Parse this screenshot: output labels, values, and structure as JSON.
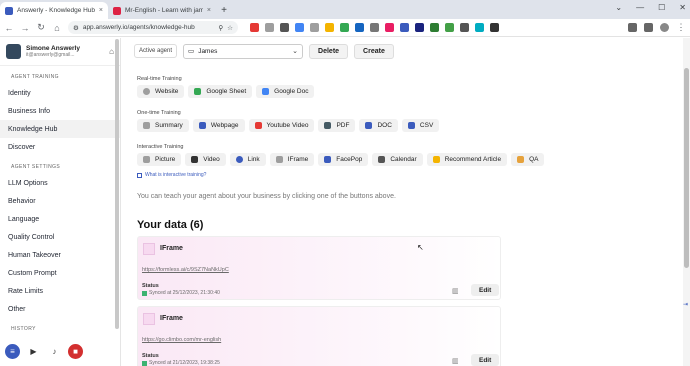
{
  "browser": {
    "tabs": [
      {
        "title": "Answerly - Knowledge Hub",
        "close": "×",
        "active": true,
        "icon": "answerly-icon",
        "color": "#3b5bbd"
      },
      {
        "title": "Mr-English - Learn with james",
        "close": "×",
        "active": false,
        "icon": "mr-english-icon",
        "color": "#d24"
      }
    ],
    "new_tab": "+",
    "window_controls": [
      "⌄",
      "—",
      "☐",
      "✕"
    ],
    "url": "app.answerly.io/agents/knowledge-hub"
  },
  "sidebar": {
    "user_name": "Simone Answerly",
    "user_email": "it@answerly@gmail...",
    "sections": [
      {
        "title": "AGENT TRAINING",
        "items": [
          "Identity",
          "Business Info",
          "Knowledge Hub",
          "Discover"
        ]
      },
      {
        "title": "AGENT SETTINGS",
        "items": [
          "LLM Options",
          "Behavior",
          "Language",
          "Quality Control",
          "Human Takeover",
          "Custom Prompt",
          "Rate Limits",
          "Other"
        ]
      },
      {
        "title": "HISTORY",
        "items": []
      }
    ],
    "active_item": "Knowledge Hub"
  },
  "topbar": {
    "active_agent_label": "Active agent",
    "agent_name": "James",
    "delete_label": "Delete",
    "create_label": "Create"
  },
  "training": {
    "realtime": {
      "label": "Real-time Training",
      "items": [
        {
          "label": "Website",
          "icon": "globe-icon",
          "color": "#9e9e9e"
        },
        {
          "label": "Google Sheet",
          "icon": "google-sheet-icon",
          "color": "#34a853"
        },
        {
          "label": "Google Doc",
          "icon": "google-doc-icon",
          "color": "#4285f4"
        }
      ]
    },
    "onetime": {
      "label": "One-time Training",
      "items": [
        {
          "label": "Summary",
          "icon": "summary-icon",
          "color": "#9e9e9e"
        },
        {
          "label": "Webpage",
          "icon": "webpage-icon",
          "color": "#3b5bbd"
        },
        {
          "label": "Youtube Video",
          "icon": "youtube-icon",
          "color": "#e53935"
        },
        {
          "label": "PDF",
          "icon": "pdf-icon",
          "color": "#455a64"
        },
        {
          "label": "DOC",
          "icon": "doc-icon",
          "color": "#3b5bbd"
        },
        {
          "label": "CSV",
          "icon": "csv-icon",
          "color": "#3b5bbd"
        }
      ]
    },
    "interactive": {
      "label": "Interactive Training",
      "items": [
        {
          "label": "Picture",
          "icon": "picture-icon",
          "color": "#9e9e9e"
        },
        {
          "label": "Video",
          "icon": "video-icon",
          "color": "#333"
        },
        {
          "label": "Link",
          "icon": "link-icon",
          "color": "#3b5bbd"
        },
        {
          "label": "IFrame",
          "icon": "iframe-icon",
          "color": "#9e9e9e"
        },
        {
          "label": "FacePop",
          "icon": "facepop-icon",
          "color": "#3b5bbd"
        },
        {
          "label": "Calendar",
          "icon": "calendar-icon",
          "color": "#555"
        },
        {
          "label": "Recommend Article",
          "icon": "star-icon",
          "color": "#f4b400"
        },
        {
          "label": "QA",
          "icon": "qa-icon",
          "color": "#e6a23c"
        }
      ]
    },
    "what_is_link": "What is interactive training?"
  },
  "hint": "You can teach your agent about your business by clicking one of the buttons above.",
  "your_data_title": "Your data (6)",
  "cards": [
    {
      "type": "IFrame",
      "url": "https://formless.ai/c/9SZ7NaNkUpC",
      "status_label": "Status",
      "synced": "Synced at 25/12/2023, 21:30:40",
      "edit_label": "Edit"
    },
    {
      "type": "IFrame",
      "url": "https://go.climbo.com/mr-english",
      "status_label": "Status",
      "synced": "Synced at 21/12/2023, 19:38:25",
      "edit_label": "Edit"
    }
  ]
}
